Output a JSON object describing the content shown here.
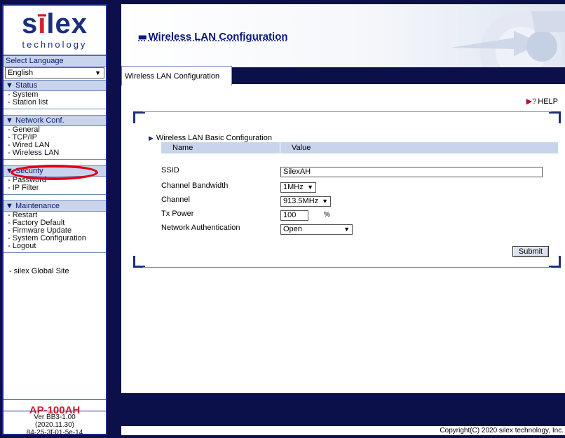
{
  "sidebar": {
    "logo_brand_pre": "s",
    "logo_brand_dot": "ī",
    "logo_brand_post": "lex",
    "logo_sub": "technology",
    "select_language_label": "Select Language",
    "language_value": "English",
    "status": {
      "header": "▼ Status",
      "items": [
        "System",
        "Station list"
      ]
    },
    "network": {
      "header": "▼ Network Conf.",
      "items": [
        "General",
        "TCP/IP",
        "Wired LAN",
        "Wireless LAN"
      ]
    },
    "security": {
      "header": "▼ Security",
      "items": [
        "Password",
        "IP Filter"
      ]
    },
    "maintenance": {
      "header": "▼ Maintenance",
      "items": [
        "Restart",
        "Factory Default",
        "Firmware Update",
        "System Configuration",
        "Logout"
      ]
    },
    "global_site": "- silex Global Site",
    "model": "AP-100AH",
    "version_lines": [
      "Ver BB3-1.00",
      "(2020.11.30)",
      "84-25-3f-01-5e-14"
    ]
  },
  "main": {
    "title": "Wireless LAN Configuration",
    "tab": "Wireless LAN Configuration",
    "help": "HELP",
    "section_title": "Wireless LAN Basic Configuration",
    "table_head": {
      "name": "Name",
      "value": "Value"
    },
    "rows": [
      {
        "label": "SSID",
        "value": "SilexAH"
      },
      {
        "label": "Channel Bandwidth",
        "value": "1MHz"
      },
      {
        "label": "Channel",
        "value": "913.5MHz"
      },
      {
        "label": "Tx Power",
        "value": "100",
        "unit": "%"
      },
      {
        "label": "Network Authentication",
        "value": "Open"
      }
    ],
    "submit": "Submit",
    "copyright": "Copyright(C) 2020 silex technology, Inc."
  },
  "colors": {
    "navy": "#0b0f4a",
    "brand_blue": "#1b2f7a",
    "brand_red": "#d61f2b",
    "highlight": "#e0001a"
  }
}
